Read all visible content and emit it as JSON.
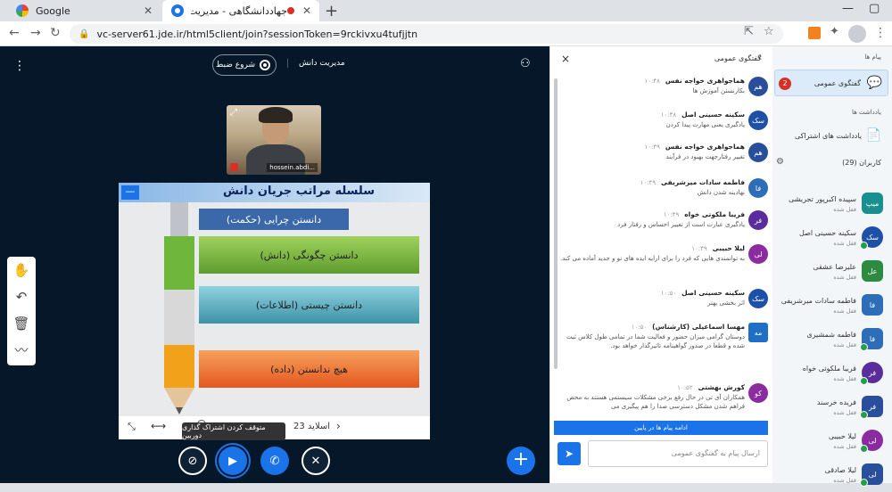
{
  "browser": {
    "tabs": [
      {
        "title": "Google",
        "close": "✕"
      },
      {
        "title": "جهاددانشگاهی - مدیریت دانش",
        "close": "✕"
      }
    ],
    "new_tab": "+",
    "window_controls": [
      "—",
      "▢"
    ],
    "url": "vc-server61.jde.ir/html5client/join?sessionToken=9rckivxu4tufjjtn",
    "nav": {
      "back": "←",
      "forward": "→",
      "reload": "↻"
    },
    "omni_icons": {
      "share": "⇱",
      "star": "☆"
    },
    "ext_puzzle": "✦",
    "kebab": "⋮"
  },
  "main": {
    "kebab": "⋮",
    "record_label": "شروع ضبط",
    "meeting_title": "مدیریت دانش",
    "user_icon": "⚇",
    "webcam_name": "hossein.abdi...",
    "webcam_expand": "⤢",
    "slide": {
      "title": "سلسله مراتب جریان دانش",
      "min": "—",
      "bars": [
        "دانستن چرایی (حکمت)",
        "دانستن چگونگی (دانش)",
        "دانستن چیستی (اطلاعات)",
        "هیچ ندانستن (داده)"
      ],
      "fit": "⤡",
      "fit_width": "⟷",
      "page_label": "اسلاید 23",
      "next": "›"
    },
    "tooltip": "متوقف کردن اشتراک گذاری دوربین",
    "tools": [
      "✋",
      "↶",
      "🗑",
      "〰"
    ],
    "actions": {
      "screen": "⊘",
      "camera": "▶",
      "phone": "✆",
      "mic": "✕",
      "plus": "+"
    }
  },
  "chat": {
    "title": "گفتگوی عمومی",
    "close": "×",
    "back": "‹",
    "messages": [
      {
        "initials": "هم",
        "color": "#2a4f9a",
        "name": "هماجواهری خواجه نفس",
        "time": "۱۰:۴۸",
        "text": "بکارنستن آموزش ها"
      },
      {
        "initials": "سک",
        "color": "#1f50a8",
        "name": "سکینه حسینی اصل",
        "time": "۱۰:۴۸",
        "text": "یادگیری یعنی مهارت پیدا کردن"
      },
      {
        "initials": "هم",
        "color": "#2a4f9a",
        "name": "هماجواهری خواجه نفس",
        "time": "۱۰:۴۹",
        "text": "تغییر رفتارجهت بهبود در فرآیند"
      },
      {
        "initials": "فا",
        "color": "#2e6db8",
        "name": "فاطمه سادات میرشریفی",
        "time": "۱۰:۴۹",
        "text": "نهادینه شدن دانش"
      },
      {
        "initials": "فر",
        "color": "#5b2c9c",
        "name": "فریبا ملکوتی خواه",
        "time": "۱۰:۴۹",
        "text": "یادگیری عبارت است از تغییر احساس و رفتار فرد"
      },
      {
        "initials": "لی",
        "color": "#8a2ca0",
        "name": "لیلا حبیبی",
        "time": "۱۰:۴۹",
        "text": "به توانمندی هایی که فرد را برای ارایه ایده های نو و جدید آماده می کند."
      },
      {
        "initials": "سک",
        "color": "#1f50a8",
        "name": "سکینه حسینی اصل",
        "time": "۱۰:۵۰",
        "text": "اثر بخشی بهتر"
      },
      {
        "initials": "مه",
        "color": "#1f6fc6",
        "name": "مهسا اسماعیلی (کارشناس)",
        "time": "۱۰:۵۰",
        "text": "دوستان گرامی میزان حضور و فعالیت شما در تمامی طول کلاس ثبت شده و قطعا در صدور گواهینامه تاثیرگذار خواهد بود."
      },
      {
        "initials": "کو",
        "color": "#8a2ca0",
        "name": "کورش بهشتی",
        "time": "۱۰:۵۲",
        "text": "همکاران آی تی در حال رفع برخی مشکلات سیستمی هستند به محض فراهم شدن مشکل دسترسی صدا را هم پیگیری می"
      }
    ],
    "more_label": "ادامه پیام ها در پایین",
    "input_placeholder": "ارسال پیام به گفتگوی عمومی",
    "send": "➤"
  },
  "users_panel": {
    "messages_title": "پیام ها",
    "public_chat": {
      "label": "گفتگوی عمومی",
      "badge": "2",
      "icon": "💬"
    },
    "notes_title": "یادداشت ها",
    "shared_notes": {
      "label": "یادداشت های اشتراکی",
      "icon": "📄"
    },
    "users_title": "کاربران (29)",
    "gear": "⚙",
    "users": [
      {
        "initials": "میپ",
        "color": "#1a8f8f",
        "name": "سپیده اکبرپور تجریشی",
        "status": "قفل شده",
        "round": false
      },
      {
        "initials": "سک",
        "color": "#1f50a8",
        "name": "سکینه حسینی اصل",
        "status": "قفل شده",
        "round": true
      },
      {
        "initials": "عل",
        "color": "#2e8a40",
        "name": "علیرضا عشقی",
        "status": "قفل شده",
        "round": false
      },
      {
        "initials": "فا",
        "color": "#2e6db8",
        "name": "فاطمه سادات میرشریفی",
        "status": "قفل شده",
        "round": false
      },
      {
        "initials": "فا",
        "color": "#2e6db8",
        "name": "فاطمه شمشیری",
        "status": "قفل شده",
        "round": false
      },
      {
        "initials": "فر",
        "color": "#5b2c9c",
        "name": "فریبا ملکوتی خواه",
        "status": "قفل شده",
        "round": true
      },
      {
        "initials": "فر",
        "color": "#2a4f9a",
        "name": "فریده خرسند",
        "status": "قفل شده",
        "round": false
      },
      {
        "initials": "لی",
        "color": "#8a2ca0",
        "name": "لیلا حبیبی",
        "status": "قفل شده",
        "round": true
      },
      {
        "initials": "لی",
        "color": "#2a4f9a",
        "name": "لیلا صادقی",
        "status": "قفل شده",
        "round": false
      }
    ]
  }
}
